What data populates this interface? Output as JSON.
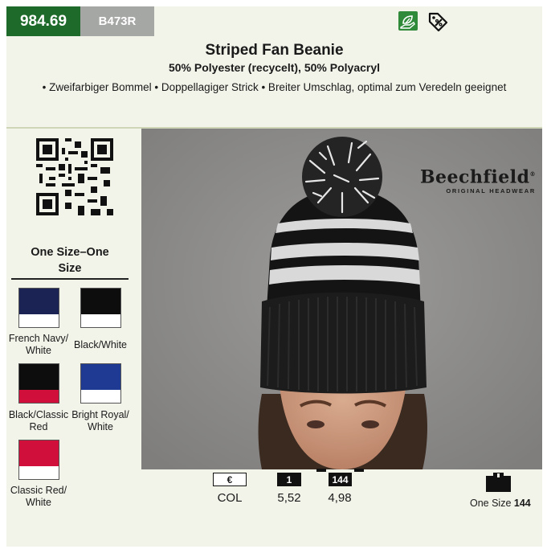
{
  "header": {
    "article_number": "984.69",
    "supplier_code": "B473R",
    "eco_icon": "eco-leaf-hand-icon",
    "tag_icon": "percent-tag-icon"
  },
  "product": {
    "title": "Striped Fan Beanie",
    "material": "50% Polyester (recycelt), 50% Polyacryl",
    "features": "• Zweifarbiger Bommel • Doppellagiger Strick • Breiter Umschlag, optimal zum Veredeln geeignet"
  },
  "sizes": {
    "line1": "One Size–One",
    "line2": "Size"
  },
  "colors": [
    {
      "line1": "French Navy/",
      "line2": "White",
      "top": "#1b2355",
      "bottom": "#ffffff"
    },
    {
      "line1": "Black/White",
      "line2": "",
      "top": "#0d0d0d",
      "bottom": "#ffffff"
    },
    {
      "line1": "Black/Classic",
      "line2": "Red",
      "top": "#0d0d0d",
      "bottom": "#d0103a"
    },
    {
      "line1": "Bright Royal/",
      "line2": "White",
      "top": "#1e3a93",
      "bottom": "#ffffff"
    },
    {
      "line1": "Classic Red/",
      "line2": "White",
      "top": "#d0103a",
      "bottom": "#ffffff"
    }
  ],
  "brand": {
    "name": "Beechfield",
    "registered": "®",
    "subtitle": "ORIGINAL HEADWEAR"
  },
  "pricing": {
    "currency": "€",
    "currency_label": "COL",
    "tiers": [
      {
        "qty": "1",
        "price": "5,52"
      },
      {
        "qty": "144",
        "price": "4,98"
      }
    ],
    "carton_prefix": "One Size",
    "carton_qty": "144"
  }
}
